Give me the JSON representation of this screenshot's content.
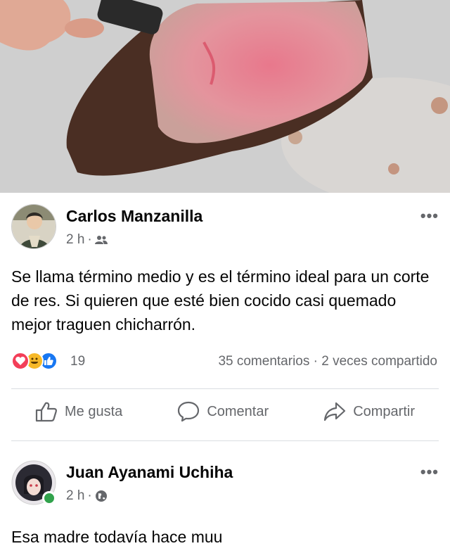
{
  "post1": {
    "author": "Carlos Manzanilla",
    "time": "2 h",
    "separator": "·",
    "audience_icon": "friends-icon",
    "text": "Se llama término medio y es el término ideal para un corte de res. Si quieren que esté bien cocido casi quemado mejor traguen chicharrón.",
    "reaction_count": "19",
    "comments": "35 comentarios",
    "shares": "2 veces compartido",
    "stats_separator": "·",
    "actions": {
      "like": "Me gusta",
      "comment": "Comentar",
      "share": "Compartir"
    }
  },
  "post2": {
    "author": "Juan Ayanami Uchiha",
    "time": "2 h",
    "separator": "·",
    "audience_icon": "globe-icon",
    "text": "Esa madre todavía hace muu"
  },
  "colors": {
    "like_blue": "#1877f2",
    "love_red": "#f33e58",
    "haha_yellow": "#f7b928",
    "online_green": "#31a24c",
    "meta_grey": "#65676b"
  }
}
